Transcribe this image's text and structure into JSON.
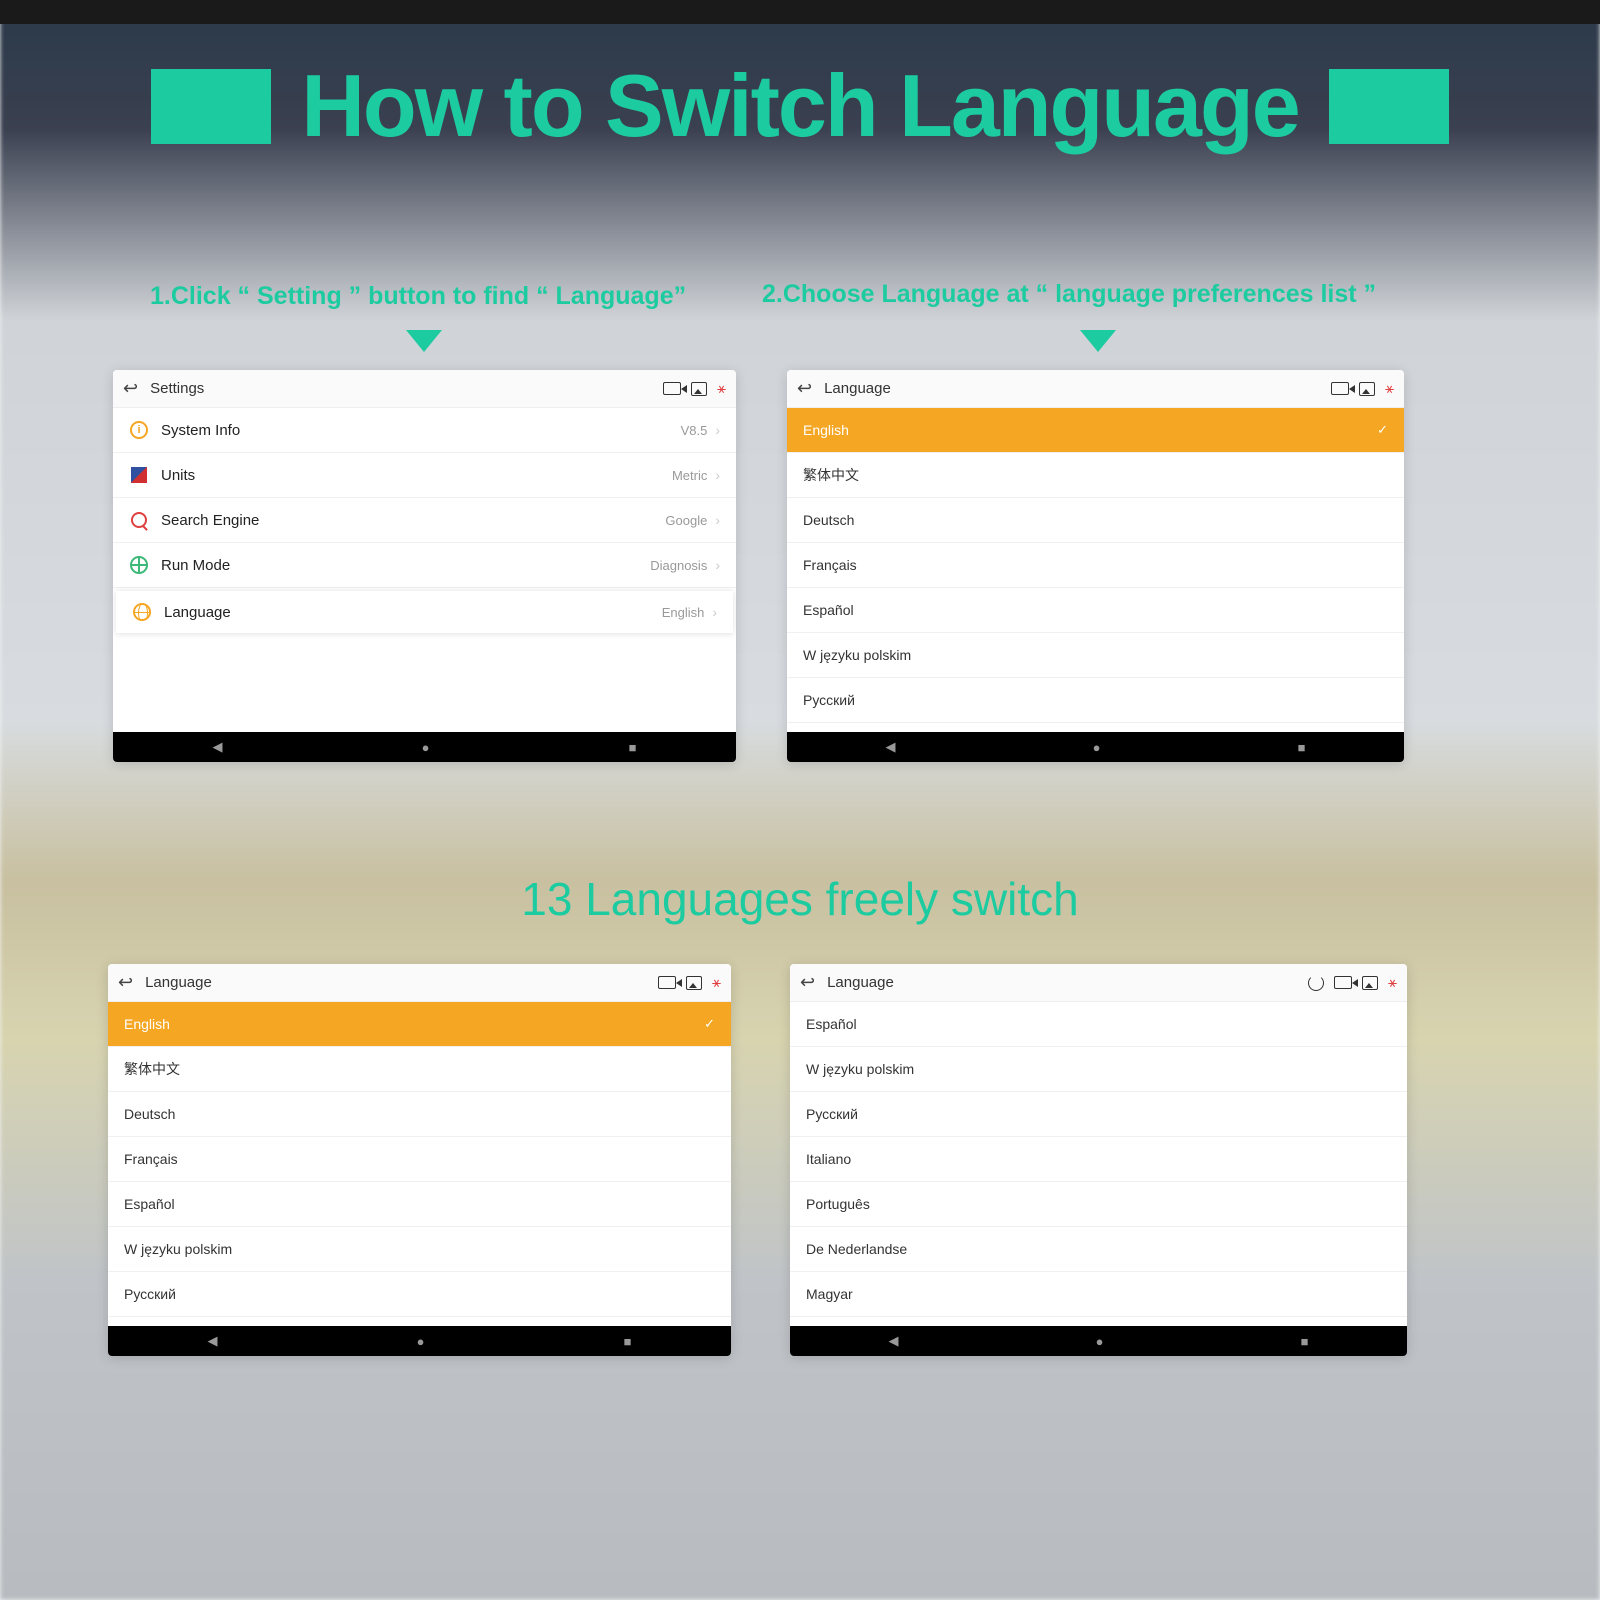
{
  "heading": "How to Switch Language",
  "instruction1": "1.Click “ Setting ” button to find “ Language”",
  "instruction2": "2.Choose Language at “ language preferences list ”",
  "sub_heading": "13 Languages freely switch",
  "screen1": {
    "title": "Settings",
    "rows": [
      {
        "label": "System Info",
        "value": "V8.5",
        "icon": "info"
      },
      {
        "label": "Units",
        "value": "Metric",
        "icon": "units"
      },
      {
        "label": "Search Engine",
        "value": "Google",
        "icon": "search"
      },
      {
        "label": "Run Mode",
        "value": "Diagnosis",
        "icon": "run"
      },
      {
        "label": "Language",
        "value": "English",
        "icon": "lang",
        "highlight": true
      }
    ]
  },
  "screen2": {
    "title": "Language",
    "items": [
      {
        "label": "English",
        "selected": true
      },
      {
        "label": "繁体中文"
      },
      {
        "label": "Deutsch"
      },
      {
        "label": "Français"
      },
      {
        "label": "Español"
      },
      {
        "label": "W języku polskim"
      },
      {
        "label": "Русский"
      }
    ]
  },
  "screen3": {
    "title": "Language",
    "items": [
      {
        "label": "English",
        "selected": true
      },
      {
        "label": "繁体中文"
      },
      {
        "label": "Deutsch"
      },
      {
        "label": "Français"
      },
      {
        "label": "Español"
      },
      {
        "label": "W języku polskim"
      },
      {
        "label": "Русский"
      }
    ]
  },
  "screen4": {
    "title": "Language",
    "refresh": true,
    "items": [
      {
        "label": "Español"
      },
      {
        "label": "W języku polskim"
      },
      {
        "label": "Русский"
      },
      {
        "label": "Italiano"
      },
      {
        "label": "Português"
      },
      {
        "label": "De Nederlandse"
      },
      {
        "label": "Magyar"
      }
    ]
  }
}
